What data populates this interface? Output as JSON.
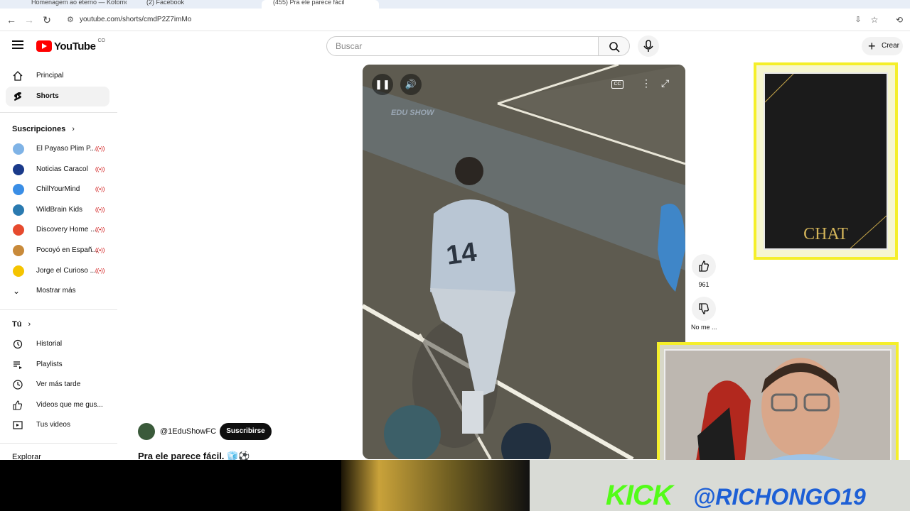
{
  "browser": {
    "url": "youtube.com/shorts/cmdP2Z7imMo",
    "tabs": [
      "Homenagem ao eterno — Kotomon",
      "(2) Facebook",
      "(455) Pra ele parece fácil"
    ]
  },
  "header": {
    "logo_text": "YouTube",
    "country_code": "CO",
    "search_placeholder": "Buscar",
    "create_label": "Crear"
  },
  "sidebar": {
    "main": [
      {
        "label": "Principal",
        "icon": "home-icon"
      },
      {
        "label": "Shorts",
        "icon": "shorts-icon",
        "active": true
      }
    ],
    "subscriptions_title": "Suscripciones",
    "subscriptions": [
      {
        "label": "El Payaso Plim P...",
        "color": "#7fb3e6"
      },
      {
        "label": "Noticias Caracol",
        "color": "#1a3a8a"
      },
      {
        "label": "ChillYourMind",
        "color": "#3a8ee6"
      },
      {
        "label": "WildBrain Kids",
        "color": "#2a7ab0"
      },
      {
        "label": "Discovery Home ...",
        "color": "#e64a2e"
      },
      {
        "label": "Pocoyó en Españ...",
        "color": "#c88a3a"
      },
      {
        "label": "Jorge el Curioso ...",
        "color": "#f5c400"
      }
    ],
    "show_more": "Mostrar más",
    "you_title": "Tú",
    "you_items": [
      {
        "label": "Historial",
        "icon": "history-icon"
      },
      {
        "label": "Playlists",
        "icon": "playlist-icon"
      },
      {
        "label": "Ver más tarde",
        "icon": "clock-icon"
      },
      {
        "label": "Videos que me gus...",
        "icon": "thumbs-up-icon"
      },
      {
        "label": "Tus videos",
        "icon": "video-icon"
      }
    ],
    "explore_title": "Explorar"
  },
  "short": {
    "channel": "@1EduShowFC",
    "subscribe_label": "Suscribirse",
    "title": "Pra ele parece fácil. 🧊⚽",
    "watermark": "EDU SHOW",
    "likes": "961",
    "dislike_label": "No me ...",
    "jersey_number": "14"
  },
  "overlay": {
    "chat_label": "CHAT",
    "kick_text": "KICK",
    "handle": "@RICHONGO19"
  },
  "colors": {
    "brand_red": "#ff0000",
    "frame_yellow": "#f5ef2a",
    "kick_green": "#53fc18",
    "live_red": "#cc0000"
  }
}
